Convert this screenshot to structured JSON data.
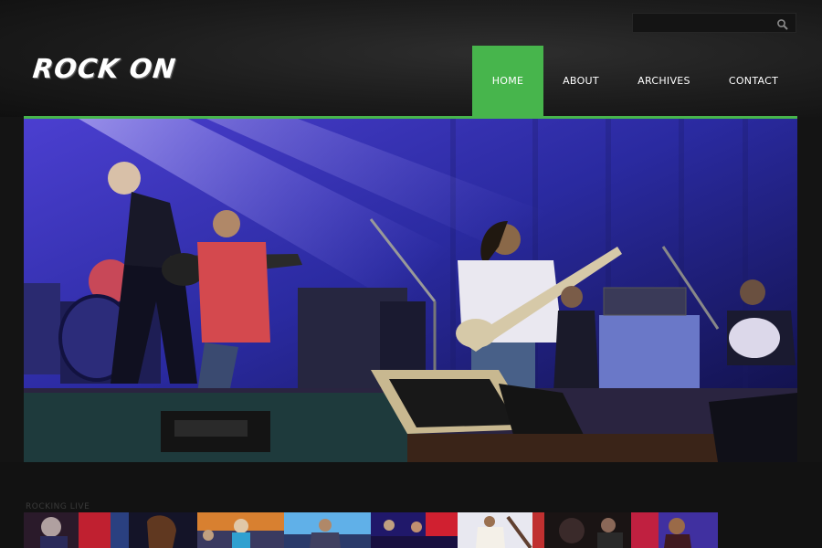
{
  "site": {
    "logo_text": "ROCK ON"
  },
  "search": {
    "placeholder": "",
    "icon": "search-icon"
  },
  "nav": {
    "items": [
      {
        "label": "HOME",
        "active": true
      },
      {
        "label": "ABOUT",
        "active": false
      },
      {
        "label": "ARCHIVES",
        "active": false
      },
      {
        "label": "CONTACT",
        "active": false
      }
    ]
  },
  "hero": {
    "image": "concert-stage-photo"
  },
  "gallery": {
    "label": "ROCKING LIVE",
    "thumbnails": [
      "thumb-singer-red",
      "thumb-singer-female",
      "thumb-band-orange",
      "thumb-guitarist-blue",
      "thumb-band-stage-red",
      "thumb-bassist-white",
      "thumb-drummer-dark",
      "thumb-singer-purple"
    ]
  },
  "colors": {
    "accent": "#47b54c",
    "background": "#141414",
    "nav_text": "#ffffff"
  }
}
